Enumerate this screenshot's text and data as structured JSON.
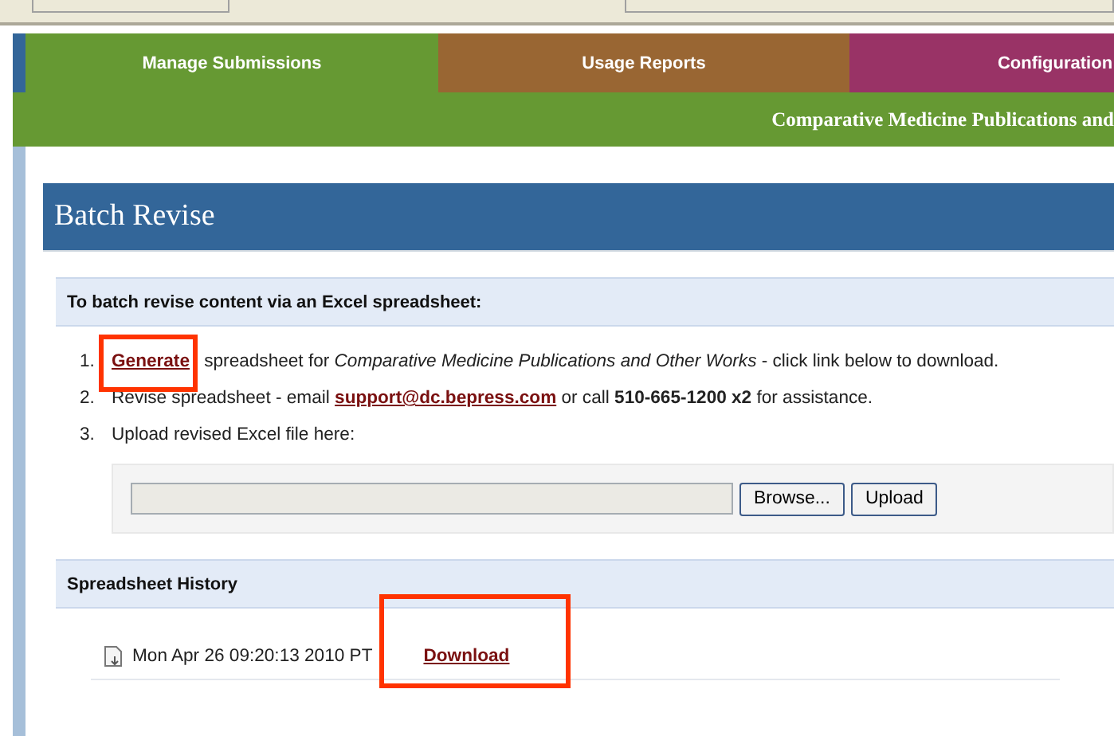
{
  "tabs": [
    {
      "label": "Manage Submissions",
      "color": "#669933",
      "selected": true
    },
    {
      "label": "Usage Reports",
      "color": "#996633",
      "selected": false
    },
    {
      "label": "Configuration",
      "color": "#993366",
      "selected": false
    }
  ],
  "subtitle": "Comparative Medicine Publications and",
  "page_title": "Batch Revise",
  "instructions": {
    "heading": "To batch revise content via an Excel spreadsheet:",
    "steps": [
      {
        "number": "1.",
        "link": {
          "label": "Generate",
          "highlighted": true
        },
        "after": " spreadsheet for *Comparative Medicine Publications and Other Works* - click link below to download."
      },
      {
        "number": "2.",
        "before": "Revise spreadsheet - email ",
        "link": {
          "label": "support@dc.bepress.com",
          "highlighted": false
        },
        "after": " or call **510-665-1200 x2** for assistance."
      },
      {
        "number": "3.",
        "before": "Upload revised Excel file here:"
      }
    ],
    "upload": {
      "browse": "Browse...",
      "submit": "Upload"
    }
  },
  "history": {
    "heading": "Spreadsheet History",
    "rows": [
      {
        "timestamp": "Mon Apr 26 09:20:13 2010 PT",
        "link": {
          "label": "Download",
          "highlighted": true
        }
      }
    ]
  }
}
